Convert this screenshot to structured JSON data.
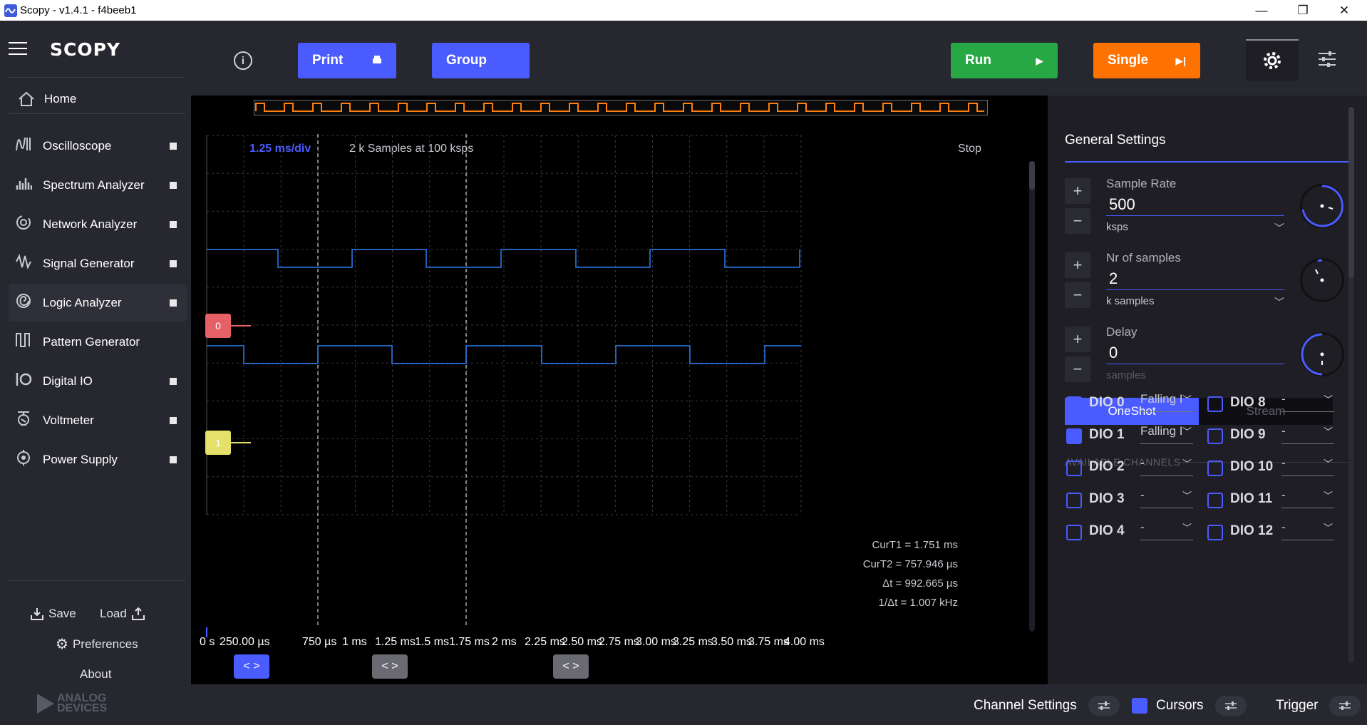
{
  "window": {
    "title": "Scopy - v1.4.1 - f4beeb1",
    "minimize": "—",
    "restore": "❐",
    "close": "✕"
  },
  "sidebar": {
    "logo": "SCOPY",
    "home": "Home",
    "items": [
      {
        "label": "Oscilloscope",
        "icon": "oscilloscope-icon"
      },
      {
        "label": "Spectrum Analyzer",
        "icon": "spectrum-icon"
      },
      {
        "label": "Network Analyzer",
        "icon": "network-icon"
      },
      {
        "label": "Signal Generator",
        "icon": "signal-icon"
      },
      {
        "label": "Logic Analyzer",
        "icon": "logic-icon"
      },
      {
        "label": "Pattern Generator",
        "icon": "pattern-icon"
      },
      {
        "label": "Digital IO",
        "icon": "digital-io-icon"
      },
      {
        "label": "Voltmeter",
        "icon": "voltmeter-icon"
      },
      {
        "label": "Power Supply",
        "icon": "power-icon"
      }
    ],
    "save": "Save",
    "load": "Load",
    "preferences": "Preferences",
    "about": "About",
    "brand": [
      "ANALOG",
      "DEVICES"
    ]
  },
  "toolbar": {
    "print": "Print",
    "group": "Group",
    "run": "Run",
    "single": "Single"
  },
  "plot": {
    "time_div": "1.25 ms/div",
    "samples_info": "2 k Samples at 100 ksps",
    "status": "Stop",
    "x_ticks": [
      "0 s",
      "250.00 µs",
      "750 µs",
      "1 ms",
      "1.25 ms",
      "1.5 ms",
      "1.75 ms",
      "2 ms",
      "2.25 ms",
      "2.50 ms",
      "2.75 ms",
      "3.00 ms",
      "3.25 ms",
      "3.50 ms",
      "3.75 ms",
      "4.00 ms"
    ],
    "channel_tags": [
      "0",
      "1"
    ],
    "readouts": [
      "CurT1 = 1.751 ms",
      "CurT2 = 757.946 µs",
      "Δt = 992.665 µs",
      "1/Δt = 1.007 kHz"
    ],
    "cursor_handle": "< >"
  },
  "settings": {
    "title": "General Settings",
    "sample_rate": {
      "label": "Sample Rate",
      "value": "500",
      "unit": "ksps"
    },
    "nr_samples": {
      "label": "Nr of samples",
      "value": "2",
      "unit": "k samples"
    },
    "delay": {
      "label": "Delay",
      "value": "0",
      "unit": "samples"
    },
    "mode_oneshot": "OneShot",
    "mode_stream": "Stream",
    "available_channels": "AVAILABLE CHANNELS",
    "channels_left": [
      {
        "name": "DIO 0",
        "checked": true,
        "trigger": "Falling I"
      },
      {
        "name": "DIO 1",
        "checked": true,
        "trigger": "Falling I"
      },
      {
        "name": "DIO 2",
        "checked": false,
        "trigger": "-"
      },
      {
        "name": "DIO 3",
        "checked": false,
        "trigger": "-"
      },
      {
        "name": "DIO 4",
        "checked": false,
        "trigger": "-"
      }
    ],
    "channels_right": [
      {
        "name": "DIO 8",
        "checked": false,
        "trigger": "-"
      },
      {
        "name": "DIO 9",
        "checked": false,
        "trigger": "-"
      },
      {
        "name": "DIO 10",
        "checked": false,
        "trigger": "-"
      },
      {
        "name": "DIO 11",
        "checked": false,
        "trigger": "-"
      },
      {
        "name": "DIO 12",
        "checked": false,
        "trigger": "-"
      }
    ]
  },
  "bottom": {
    "channel_settings": "Channel Settings",
    "cursors": "Cursors",
    "trigger": "Trigger"
  },
  "colors": {
    "accent": "#4a5cff",
    "run": "#27a844",
    "single": "#ff7200",
    "trace": "#2c7df5",
    "overview": "#ff7f0e",
    "ch0": "#e66165",
    "ch1": "#e4e06a"
  }
}
